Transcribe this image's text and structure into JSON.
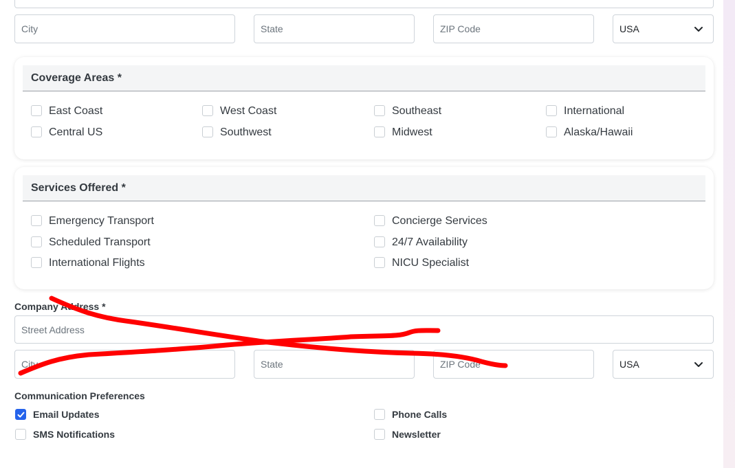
{
  "top_address": {
    "city_placeholder": "City",
    "state_placeholder": "State",
    "zip_placeholder": "ZIP Code",
    "country_value": "USA"
  },
  "coverage": {
    "title": "Coverage Areas *",
    "options": [
      "East Coast",
      "West Coast",
      "Southeast",
      "International",
      "Central US",
      "Southwest",
      "Midwest",
      "Alaska/Hawaii"
    ]
  },
  "services": {
    "title": "Services Offered *",
    "options": [
      "Emergency Transport",
      "Concierge Services",
      "Scheduled Transport",
      "24/7 Availability",
      "International Flights",
      "NICU Specialist"
    ]
  },
  "company_address": {
    "label": "Company Address *",
    "street_placeholder": "Street Address",
    "city_placeholder": "City",
    "state_placeholder": "State",
    "zip_placeholder": "ZIP Code",
    "country_value": "USA"
  },
  "communication": {
    "label": "Communication Preferences",
    "options": [
      {
        "label": "Email Updates",
        "checked": true
      },
      {
        "label": "Phone Calls",
        "checked": false
      },
      {
        "label": "SMS Notifications",
        "checked": false
      },
      {
        "label": "Newsletter",
        "checked": false
      }
    ]
  },
  "colors": {
    "accent": "#2563eb",
    "scribble": "#ff0000",
    "background_tint": "#f6eef7"
  }
}
